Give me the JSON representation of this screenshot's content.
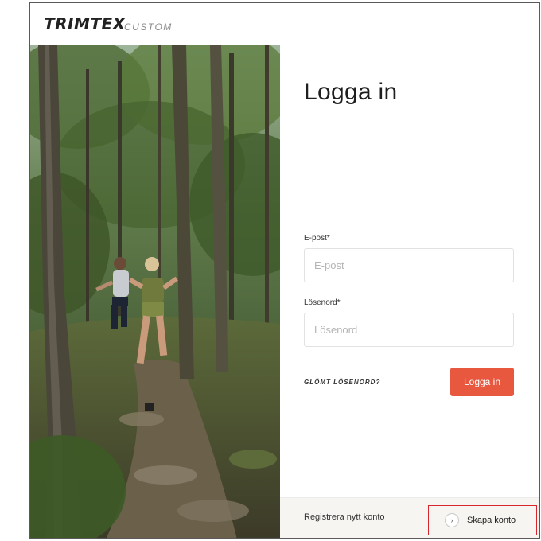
{
  "header": {
    "brand": "TRIMTEX",
    "brand_sub": "CUSTOM"
  },
  "hero_image": {
    "description_icon": "forest-runners-photo"
  },
  "login": {
    "title": "Logga in",
    "email_label": "E-post*",
    "email_placeholder": "E-post",
    "email_value": "",
    "password_label": "Lösenord*",
    "password_placeholder": "Lösenord",
    "password_value": "",
    "forgot_label": "GLÖMT LÖSENORD?",
    "submit_label": "Logga in"
  },
  "footer": {
    "register_text": "Registrera nytt konto",
    "create_account_label": "Skapa konto",
    "create_icon": "chevron-right-icon"
  },
  "colors": {
    "accent": "#e8583f",
    "highlight_border": "#d9262c",
    "footer_bg": "#f7f5f2"
  }
}
